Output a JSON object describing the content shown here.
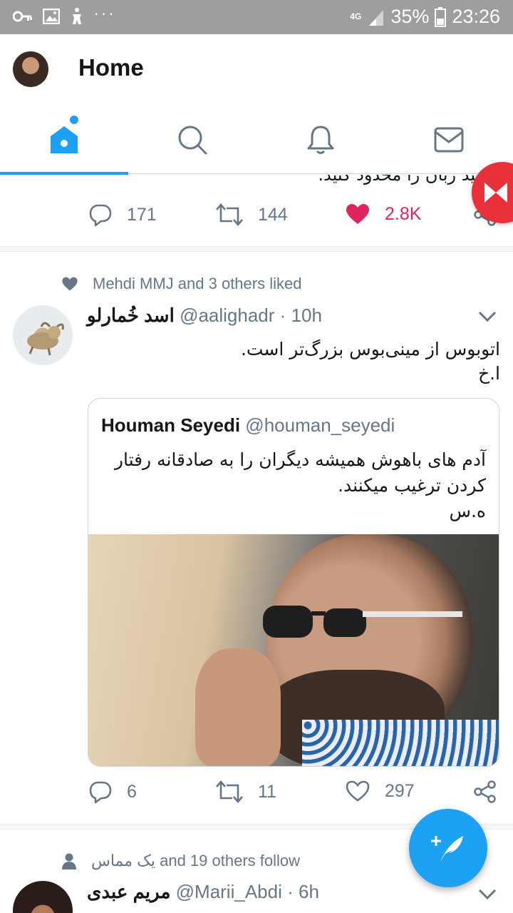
{
  "status_bar": {
    "network": "4G",
    "battery": "35%",
    "time": "23:26",
    "dots": "···"
  },
  "header": {
    "title": "Home"
  },
  "tabs": [
    {
      "name": "home",
      "icon": "home-icon",
      "active": true,
      "has_dot": true
    },
    {
      "name": "search",
      "icon": "search-icon",
      "active": false
    },
    {
      "name": "notifications",
      "icon": "bell-icon",
      "active": false
    },
    {
      "name": "messages",
      "icon": "mail-icon",
      "active": false
    }
  ],
  "prev_tweet": {
    "clipped_text": "توانید زبان را محدود کنید.",
    "replies": "171",
    "retweets": "144",
    "likes": "2.8K",
    "liked": true
  },
  "tweet": {
    "social_context": "Mehdi MMJ and 3 others liked",
    "name": "اسد خُمارلو",
    "handle": "@aalighadr",
    "sep": "·",
    "time": "10h",
    "body_line1": "اتوبوس از مینی‌بوس بزرگ‌تر است.",
    "body_line2": "ا.خ",
    "quote": {
      "name": "Houman Seyedi",
      "handle": "@houman_seyedi",
      "body_line1": "آدم های باهوش همیشه دیگران را  به صادقانه رفتار",
      "body_line2": "کردن ترغیب میکنند.",
      "body_line3": "ه.س"
    },
    "replies": "6",
    "retweets": "11",
    "likes": "297"
  },
  "next_tweet": {
    "social_context": "یک مماس and 19 others follow",
    "name": "مریم عبدی",
    "handle": "@Marii_Abdi",
    "sep": "·",
    "time": "6h"
  },
  "colors": {
    "accent": "#1da1f2",
    "like": "#e0245e",
    "muted": "#657786",
    "status_bar": "#9e9e9e"
  }
}
